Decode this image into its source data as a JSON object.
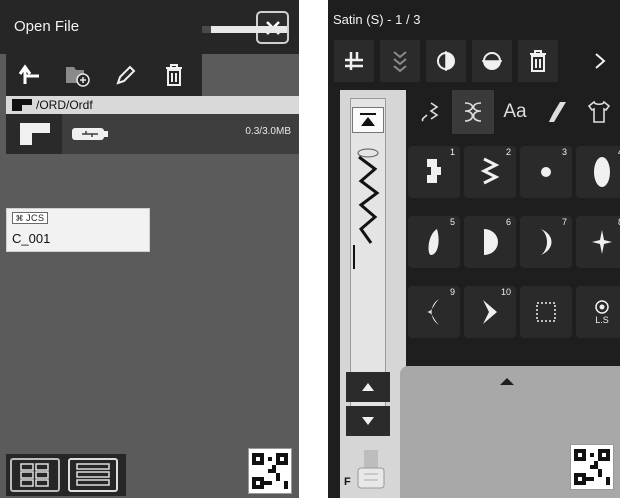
{
  "left_panel": {
    "title": "Open File",
    "path": "/ORD/Ordf",
    "storage_text": "0.3/3.0MB",
    "storage_fraction": 0.1,
    "file": {
      "badge": "JCS",
      "name": "C_001"
    },
    "toolbar_icons": [
      "back-arrow-icon",
      "new-folder-icon",
      "rename-pencil-icon",
      "delete-trash-icon"
    ],
    "view_modes": [
      "grid-view-icon",
      "list-view-icon"
    ]
  },
  "right_panel": {
    "title": "Satin (S) - 1 / 3",
    "toolbar_icons": [
      "position-icon",
      "mirror-vertical-icon",
      "mirror-horizontal-icon",
      "flip-icon",
      "delete-trash-icon",
      "chevron-right-icon"
    ],
    "categories": [
      "stitch-icon",
      "satin-icon",
      "text-icon",
      "ribbon-icon",
      "shirt-icon"
    ],
    "stitches": [
      {
        "num": "1"
      },
      {
        "num": "2"
      },
      {
        "num": "3"
      },
      {
        "num": "4"
      },
      {
        "num": "5"
      },
      {
        "num": "6"
      },
      {
        "num": "7"
      },
      {
        "num": "8"
      },
      {
        "num": "9"
      },
      {
        "num": "10"
      },
      {
        "num": ""
      },
      {
        "num": ""
      }
    ],
    "ls_label": "L.S",
    "foot_label": "F"
  }
}
